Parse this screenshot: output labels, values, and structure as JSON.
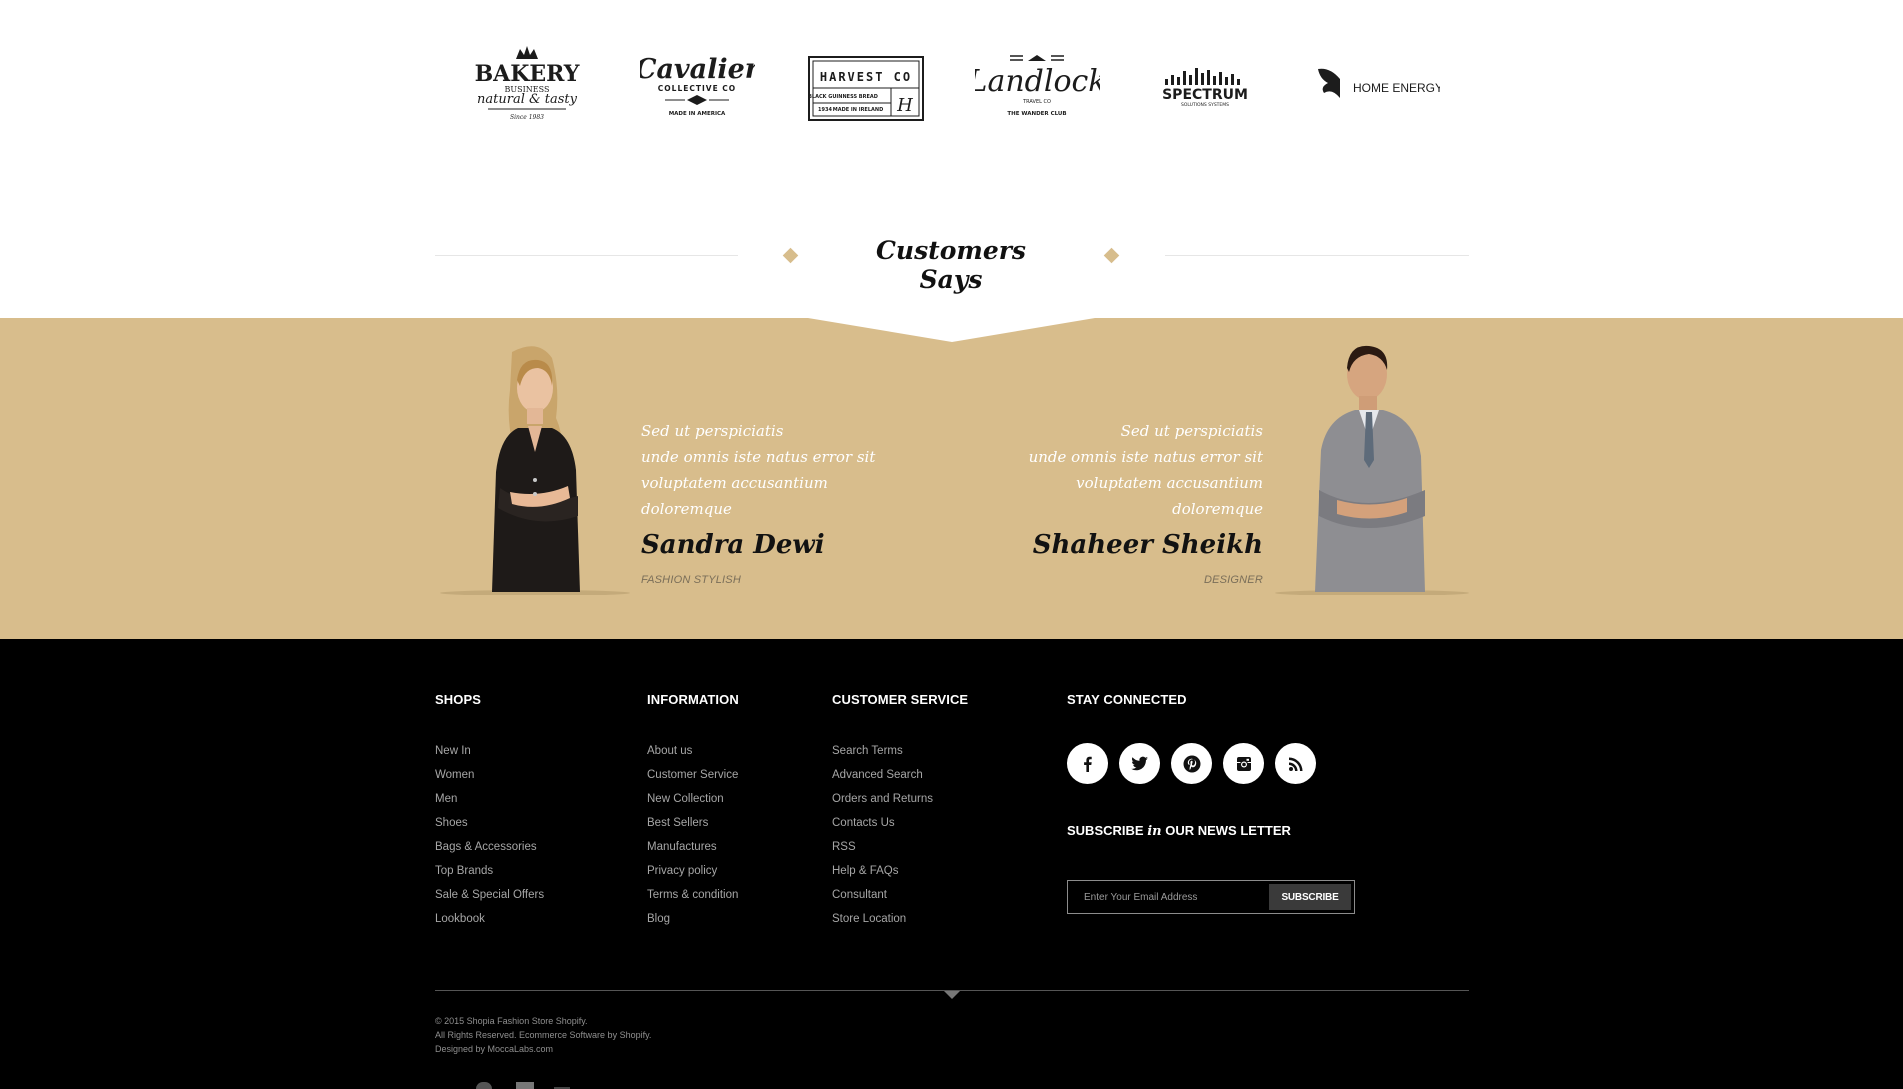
{
  "brands": [
    {
      "name": "BAKERY",
      "lines": [
        "BUSINESS",
        "natural & tasty",
        "Since 1983"
      ]
    },
    {
      "name": "Cavalier",
      "lines": [
        "COLLECTIVE CO",
        "MADE IN AMERICA"
      ]
    },
    {
      "name": "HARVEST CO",
      "lines": [
        "BLACK GUINNESS BREAD",
        "1934",
        "MADE IN IRELAND"
      ]
    },
    {
      "name": "Landlock",
      "lines": [
        "TRAVEL CO",
        "THE WANDER CLUB"
      ]
    },
    {
      "name": "SPECTRUM",
      "lines": [
        "SOLUTIONS SYSTEMS"
      ]
    },
    {
      "name": "HOME ENERGY",
      "lines": []
    }
  ],
  "testimonials": {
    "title": "Customers Says",
    "items": [
      {
        "quote": [
          "Sed ut perspiciatis",
          "unde omnis iste natus error sit",
          "voluptatem accusantium doloremque"
        ],
        "name": "Sandra Dewi",
        "role": "FASHION STYLISH"
      },
      {
        "quote": [
          "Sed ut perspiciatis",
          "unde omnis iste natus error sit",
          "voluptatem accusantium doloremque"
        ],
        "name": "Shaheer Sheikh",
        "role": "DESIGNER"
      }
    ]
  },
  "footer": {
    "shops": {
      "title": "SHOPS",
      "links": [
        "New In",
        "Women",
        "Men",
        "Shoes",
        "Bags & Accessories",
        "Top Brands",
        "Sale & Special Offers",
        "Lookbook"
      ]
    },
    "information": {
      "title": "INFORMATION",
      "links": [
        "About us",
        "Customer Service",
        "New Collection",
        "Best Sellers",
        "Manufactures",
        "Privacy policy",
        "Terms & condition",
        "Blog"
      ]
    },
    "customer_service": {
      "title": "CUSTOMER SERVICE",
      "links": [
        "Search Terms",
        "Advanced Search",
        "Orders and Returns",
        "Contacts Us",
        "RSS",
        "Help & FAQs",
        "Consultant",
        "Store Location"
      ]
    },
    "stay_connected": {
      "title": "STAY CONNECTED",
      "social_icons": [
        "facebook-icon",
        "twitter-icon",
        "pinterest-icon",
        "instagram-icon",
        "rss-icon"
      ]
    },
    "newsletter": {
      "title_pre": "SUBSCRIBE",
      "title_mid": "in",
      "title_post": "OUR NEWS LETTER",
      "placeholder": "Enter Your Email Address",
      "button": "SUBSCRIBE"
    },
    "copyright": [
      "© 2015 Shopia Fashion Store Shopify.",
      "All Rights Reserved. Ecommerce Software by Shopify.",
      "Designed by MoccaLabs.com"
    ]
  },
  "colors": {
    "accent": "#d8bd8c",
    "footer_bg": "#000000",
    "link": "#a6a6a6"
  }
}
